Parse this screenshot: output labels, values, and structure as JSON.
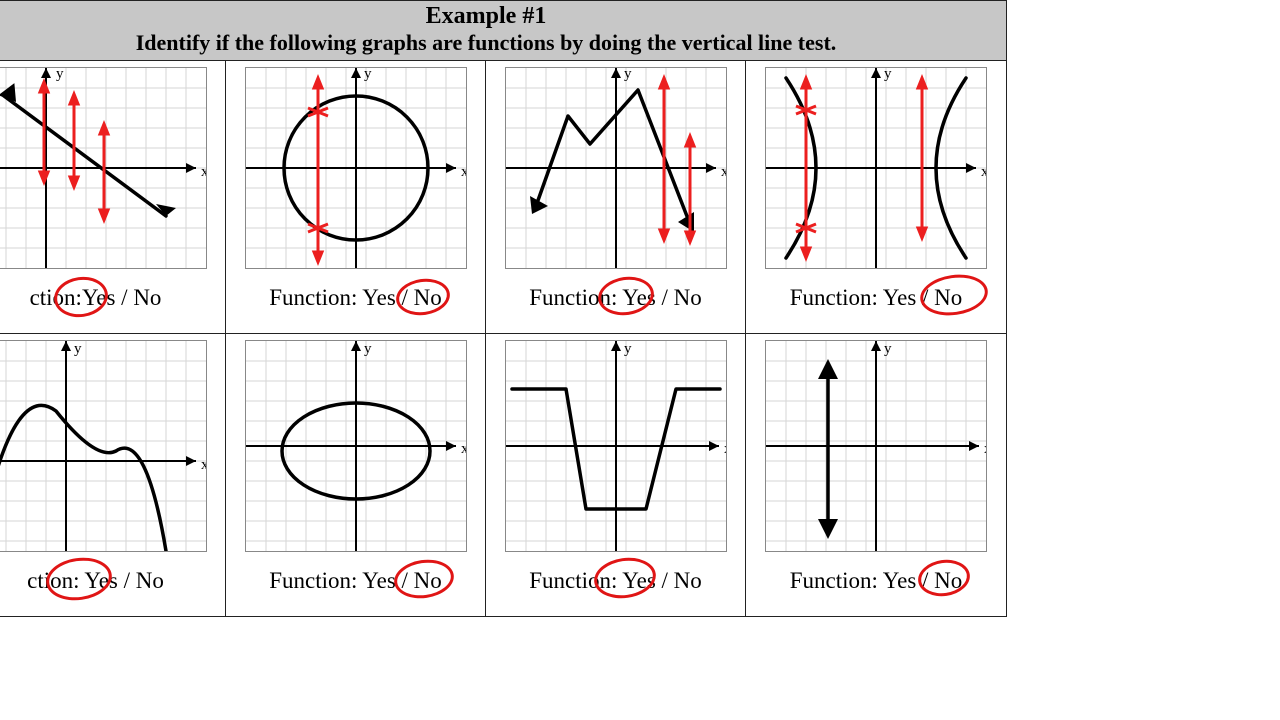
{
  "header": {
    "title": "Example #1",
    "subtitle": "Identify if the following graphs are functions by doing the vertical line test."
  },
  "cells": [
    {
      "prompt_prefix": "ction:",
      "option_yes": "Yes",
      "sep": " / ",
      "option_no": "No",
      "circled": "yes"
    },
    {
      "prompt_prefix": "Function: ",
      "option_yes": "Yes",
      "sep": " / ",
      "option_no": "No",
      "circled": "no"
    },
    {
      "prompt_prefix": "Function: ",
      "option_yes": "Yes",
      "sep": " / ",
      "option_no": "No",
      "circled": "yes"
    },
    {
      "prompt_prefix": "Function: ",
      "option_yes": "Yes",
      "sep": " / ",
      "option_no": "No",
      "circled": "no"
    },
    {
      "prompt_prefix": "ction: ",
      "option_yes": "Yes",
      "sep": " / ",
      "option_no": "No",
      "circled": "yes"
    },
    {
      "prompt_prefix": "Function: ",
      "option_yes": "Yes",
      "sep": " / ",
      "option_no": "No",
      "circled": "no"
    },
    {
      "prompt_prefix": "Function: ",
      "option_yes": "Yes",
      "sep": " / ",
      "option_no": "No",
      "circled": "yes"
    },
    {
      "prompt_prefix": "Function: ",
      "option_yes": "Yes",
      "sep": " / ",
      "option_no": "No",
      "circled": "no"
    }
  ],
  "axis": {
    "x_label": "x",
    "y_label": "y"
  }
}
